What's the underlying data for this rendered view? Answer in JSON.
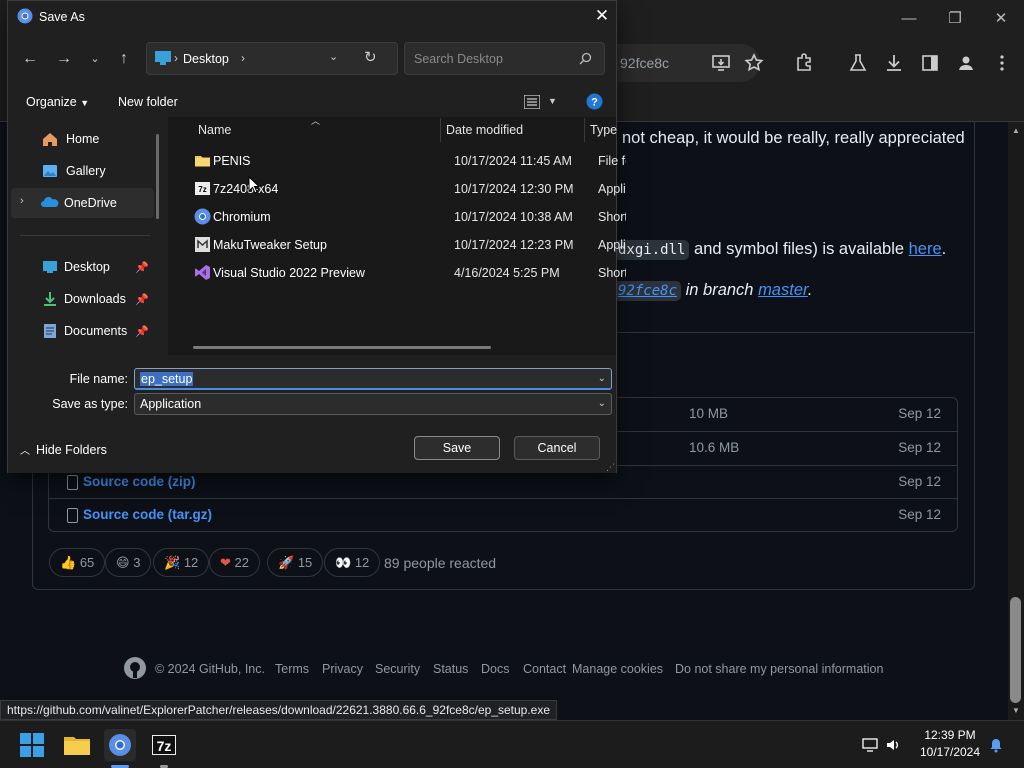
{
  "dialog": {
    "title": "Save As",
    "address": {
      "location": "Desktop",
      "separator": "›"
    },
    "search_placeholder": "Search Desktop",
    "commands": {
      "organize": "Organize",
      "new_folder": "New folder"
    },
    "nav_items": [
      {
        "label": "Home",
        "icon": "home-icon",
        "pinned": false
      },
      {
        "label": "Gallery",
        "icon": "gallery-icon",
        "pinned": false
      },
      {
        "label": "OneDrive",
        "icon": "onedrive-icon",
        "pinned": false,
        "active": true
      },
      {
        "label": "Desktop",
        "icon": "desktop-folder-icon",
        "pinned": true
      },
      {
        "label": "Downloads",
        "icon": "downloads-icon",
        "pinned": true
      },
      {
        "label": "Documents",
        "icon": "documents-icon",
        "pinned": true
      }
    ],
    "columns": {
      "name": "Name",
      "date_modified": "Date modified",
      "type": "Type"
    },
    "files": [
      {
        "name": "PENIS",
        "date": "10/17/2024 11:45 AM",
        "type": "File folder",
        "icon": "folder-icon"
      },
      {
        "name": "7z2408-x64",
        "date": "10/17/2024 12:30 PM",
        "type": "Application",
        "icon": "7zip-icon"
      },
      {
        "name": "Chromium",
        "date": "10/17/2024 10:38 AM",
        "type": "Shortcut",
        "icon": "chromium-icon"
      },
      {
        "name": "MakuTweaker Setup",
        "date": "10/17/2024 12:23 PM",
        "type": "Application",
        "icon": "installer-icon"
      },
      {
        "name": "Visual Studio 2022 Preview",
        "date": "4/16/2024 5:25 PM",
        "type": "Shortcut",
        "icon": "visual-studio-icon"
      }
    ],
    "filename_label": "File name:",
    "filename_value": "ep_setup",
    "savetype_label": "Save as type:",
    "savetype_value": "Application",
    "hide_folders": "Hide Folders",
    "save_button": "Save",
    "cancel_button": "Cancel"
  },
  "browser": {
    "omnibox_fragment": "92fce8c",
    "page_text": {
      "line1": "not cheap, it would be really, really appreciated",
      "line2_code": "dxgi.dll",
      "line2_rest": " and symbol files) is available ",
      "line2_link": "here",
      "line3_commit": "92fce8c",
      "line3_mid": " in branch ",
      "line3_branch": "master"
    },
    "assets": [
      {
        "name": "",
        "size": "10 MB",
        "date": "Sep 12"
      },
      {
        "name": "",
        "size": "10.6 MB",
        "date": "Sep 12"
      },
      {
        "name": "Source code (zip)",
        "size": "",
        "date": "Sep 12"
      },
      {
        "name": "Source code (tar.gz)",
        "size": "",
        "date": "Sep 12"
      }
    ],
    "reactions": [
      {
        "emoji": "👍",
        "count": "65"
      },
      {
        "emoji": "😄",
        "count": "3"
      },
      {
        "emoji": "🎉",
        "count": "12"
      },
      {
        "emoji": "❤",
        "count": "22"
      },
      {
        "emoji": "🚀",
        "count": "15"
      },
      {
        "emoji": "👀",
        "count": "12"
      }
    ],
    "reacted_text": "89 people reacted",
    "footer": {
      "copyright": "© 2024 GitHub, Inc.",
      "links": [
        "Terms",
        "Privacy",
        "Security",
        "Status",
        "Docs",
        "Contact",
        "Manage cookies",
        "Do not share my personal information"
      ]
    },
    "status_url": "https://github.com/valinet/ExplorerPatcher/releases/download/22621.3880.66.6_92fce8c/ep_setup.exe"
  },
  "taskbar": {
    "apps": [
      "start-icon",
      "file-explorer-icon",
      "chrome-icon",
      "7zip-icon"
    ],
    "time": "12:39 PM",
    "date": "10/17/2024"
  },
  "colors": {
    "link": "#4493f8",
    "selection": "#3d6fc4",
    "dialog_bg": "#202020",
    "page_bg": "#0d1117"
  }
}
